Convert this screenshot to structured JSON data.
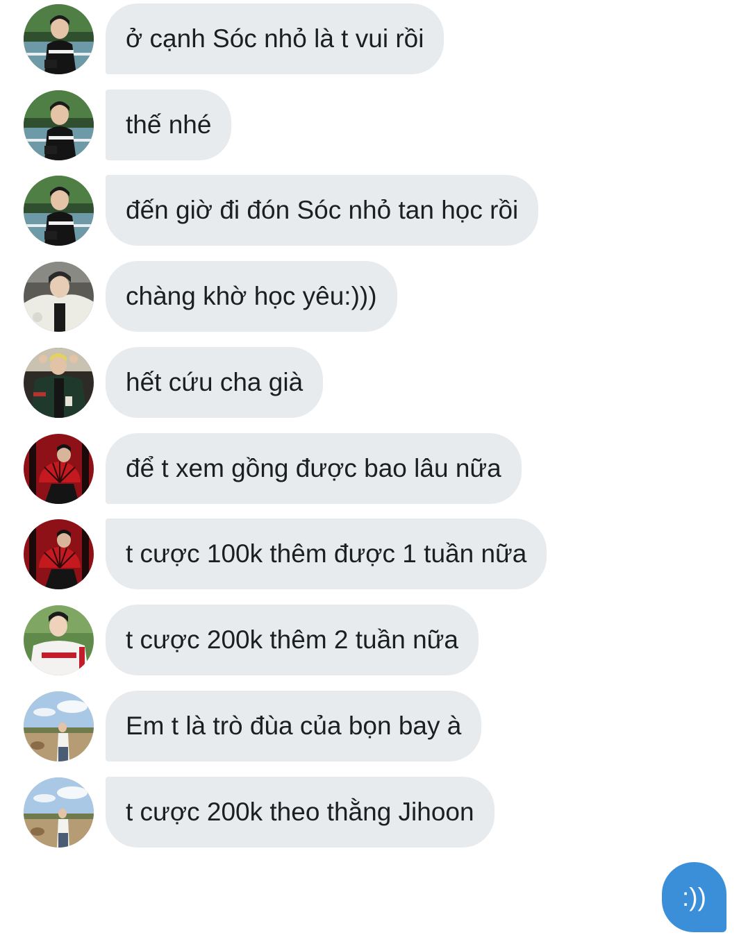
{
  "colors": {
    "incoming_bubble": "#e8ebee",
    "incoming_text": "#1c1e21",
    "outgoing_bubble": "#3b8fd8",
    "outgoing_text": "#ffffff",
    "background": "#ffffff"
  },
  "messages": [
    {
      "text": "ở cạnh Sóc nhỏ là t vui rồi",
      "avatar": "avatar-basketball-court"
    },
    {
      "text": "thế nhé",
      "avatar": "avatar-basketball-court"
    },
    {
      "text": "đến giờ đi đón Sóc nhỏ tan học rồi",
      "avatar": "avatar-basketball-court"
    },
    {
      "text": "chàng khờ học yêu:)))",
      "avatar": "avatar-white-fleece"
    },
    {
      "text": "hết cứu cha già",
      "avatar": "avatar-varsity-jacket"
    },
    {
      "text": "để t xem gồng được bao lâu nữa",
      "avatar": "avatar-red-fan"
    },
    {
      "text": "t cược 100k thêm được 1 tuần nữa",
      "avatar": "avatar-red-fan"
    },
    {
      "text": "t cược 200k thêm 2 tuần nữa",
      "avatar": "avatar-baseball-jersey"
    },
    {
      "text": "Em t là trò đùa của bọn bay à",
      "avatar": "avatar-field-sky"
    },
    {
      "text": "t cược 200k theo thằng Jihoon",
      "avatar": "avatar-field-sky"
    }
  ],
  "outgoing": {
    "text": ":))"
  }
}
